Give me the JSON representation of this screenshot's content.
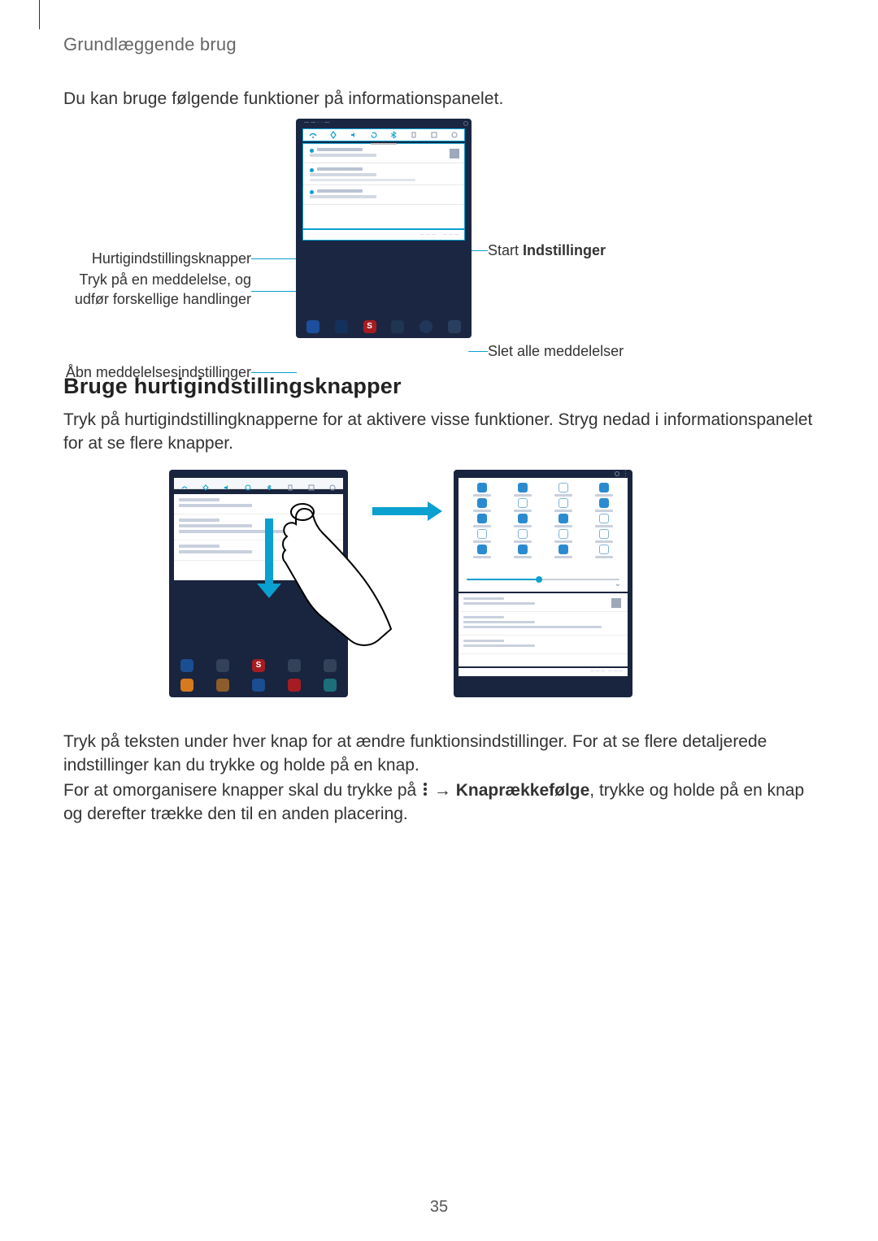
{
  "header": {
    "chapter": "Grundlæggende brug"
  },
  "intro": "Du kan bruge følgende funktioner på informationspanelet.",
  "figure1": {
    "callouts_left": [
      "Hurtigindstillingsknapper",
      "Tryk på en meddelelse, og udfør forskellige handlinger",
      "Åbn meddelelsesindstillinger"
    ],
    "callouts_right_prefix": "Start ",
    "callouts_right_bold": "Indstillinger",
    "callouts_right_2": "Slet alle meddelelser"
  },
  "section2": {
    "heading": "Bruge hurtigindstillingsknapper",
    "paragraph": "Tryk på hurtigindstillingknapperne for at aktivere visse funktioner. Stryg nedad i informationspanelet for at se flere knapper."
  },
  "para3": "Tryk på teksten under hver knap for at ændre funktionsindstillinger. For at se flere detaljerede indstillinger kan du trykke og holde på en knap.",
  "para4_a": "For at omorganisere knapper skal du trykke på ",
  "para4_arrow": " → ",
  "para4_bold": "Knaprækkefølge",
  "para4_b": ", trykke og holde på en knap og derefter trække den til en anden placering.",
  "page_number": "35"
}
